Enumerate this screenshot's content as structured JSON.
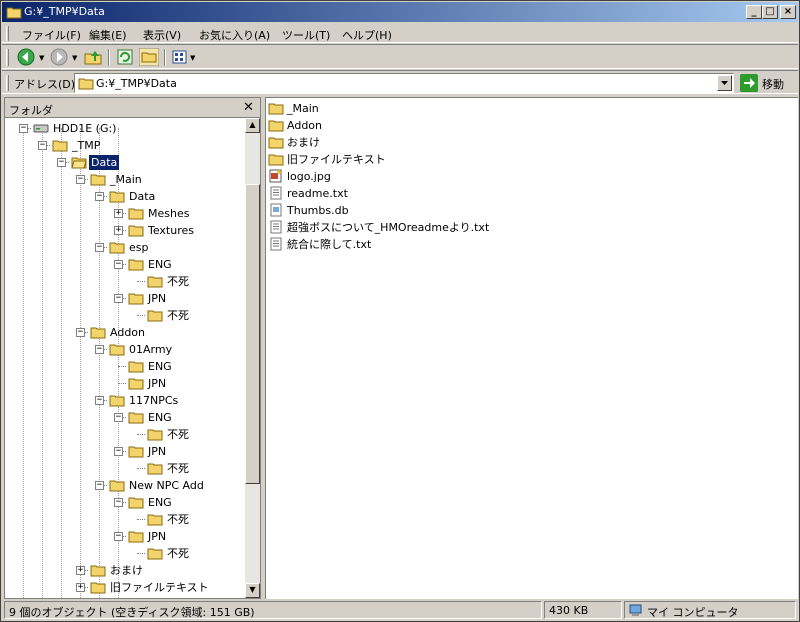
{
  "window": {
    "title": "G:¥_TMP¥Data"
  },
  "menu": [
    "ファイル(F)",
    "編集(E)",
    "表示(V)",
    "お気に入り(A)",
    "ツール(T)",
    "ヘルプ(H)"
  ],
  "address": {
    "label": "アドレス(D)",
    "value": "G:¥_TMP¥Data",
    "go_label": "移動"
  },
  "folder_pane": {
    "title": "フォルダ",
    "tree": [
      {
        "label": "HDD1E (G:)",
        "level": 0,
        "toggle": "-",
        "icon": "drive"
      },
      {
        "label": "_TMP",
        "level": 1,
        "toggle": "-",
        "icon": "folder"
      },
      {
        "label": "Data",
        "level": 2,
        "toggle": "-",
        "icon": "folder-open",
        "selected": true
      },
      {
        "label": "_Main",
        "level": 3,
        "toggle": "-",
        "icon": "folder"
      },
      {
        "label": "Data",
        "level": 4,
        "toggle": "-",
        "icon": "folder"
      },
      {
        "label": "Meshes",
        "level": 5,
        "toggle": "+",
        "icon": "folder"
      },
      {
        "label": "Textures",
        "level": 5,
        "toggle": "+",
        "icon": "folder"
      },
      {
        "label": "esp",
        "level": 4,
        "toggle": "-",
        "icon": "folder"
      },
      {
        "label": "ENG",
        "level": 5,
        "toggle": "-",
        "icon": "folder"
      },
      {
        "label": "不死",
        "level": 6,
        "toggle": "",
        "icon": "folder"
      },
      {
        "label": "JPN",
        "level": 5,
        "toggle": "-",
        "icon": "folder"
      },
      {
        "label": "不死",
        "level": 6,
        "toggle": "",
        "icon": "folder"
      },
      {
        "label": "Addon",
        "level": 3,
        "toggle": "-",
        "icon": "folder"
      },
      {
        "label": "01Army",
        "level": 4,
        "toggle": "-",
        "icon": "folder"
      },
      {
        "label": "ENG",
        "level": 5,
        "toggle": "",
        "icon": "folder"
      },
      {
        "label": "JPN",
        "level": 5,
        "toggle": "",
        "icon": "folder"
      },
      {
        "label": "117NPCs",
        "level": 4,
        "toggle": "-",
        "icon": "folder"
      },
      {
        "label": "ENG",
        "level": 5,
        "toggle": "-",
        "icon": "folder"
      },
      {
        "label": "不死",
        "level": 6,
        "toggle": "",
        "icon": "folder"
      },
      {
        "label": "JPN",
        "level": 5,
        "toggle": "-",
        "icon": "folder"
      },
      {
        "label": "不死",
        "level": 6,
        "toggle": "",
        "icon": "folder"
      },
      {
        "label": "New NPC Add",
        "level": 4,
        "toggle": "-",
        "icon": "folder"
      },
      {
        "label": "ENG",
        "level": 5,
        "toggle": "-",
        "icon": "folder"
      },
      {
        "label": "不死",
        "level": 6,
        "toggle": "",
        "icon": "folder"
      },
      {
        "label": "JPN",
        "level": 5,
        "toggle": "-",
        "icon": "folder"
      },
      {
        "label": "不死",
        "level": 6,
        "toggle": "",
        "icon": "folder"
      },
      {
        "label": "おまけ",
        "level": 3,
        "toggle": "+",
        "icon": "folder"
      },
      {
        "label": "旧ファイルテキスト",
        "level": 3,
        "toggle": "+",
        "icon": "folder"
      }
    ]
  },
  "files": [
    {
      "name": "_Main",
      "type": "folder"
    },
    {
      "name": "Addon",
      "type": "folder"
    },
    {
      "name": "おまけ",
      "type": "folder"
    },
    {
      "name": "旧ファイルテキスト",
      "type": "folder"
    },
    {
      "name": "logo.jpg",
      "type": "image"
    },
    {
      "name": "readme.txt",
      "type": "text"
    },
    {
      "name": "Thumbs.db",
      "type": "db"
    },
    {
      "name": "超強ボスについて_HMOreadmeより.txt",
      "type": "text"
    },
    {
      "name": "統合に際して.txt",
      "type": "text"
    }
  ],
  "status": {
    "objects": "9 個のオブジェクト (空きディスク領域: 151 GB)",
    "size": "430 KB",
    "zone": "マイ コンピュータ"
  }
}
